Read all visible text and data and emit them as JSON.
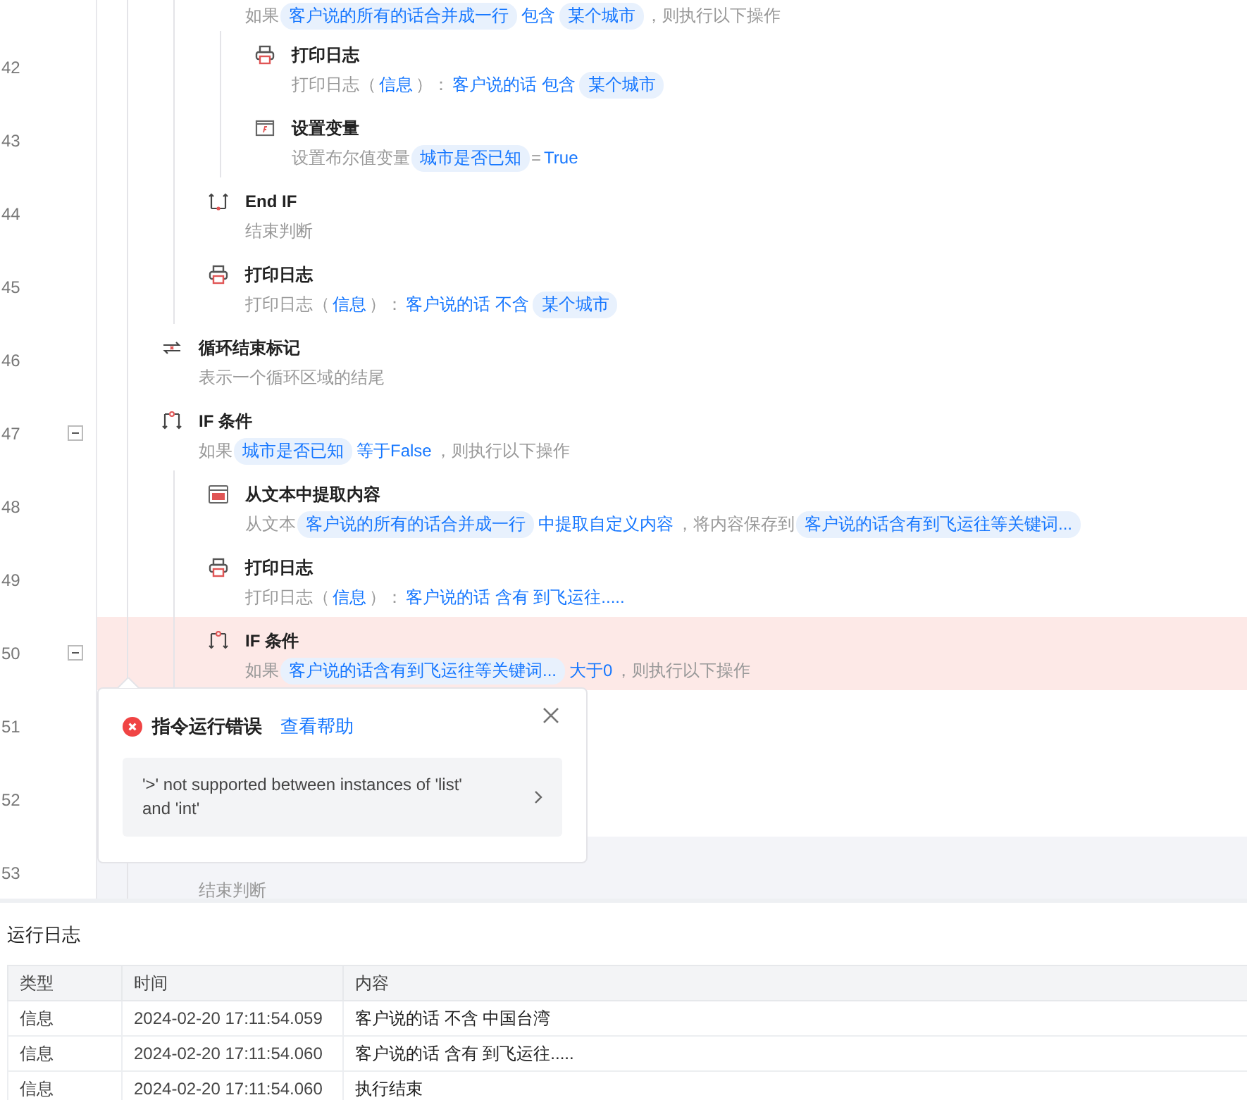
{
  "loop_body": [
    {
      "description": [
        {
          "text": "如果",
          "kind": "plain"
        },
        {
          "text": "客户说的所有的话合并成一行",
          "kind": "var"
        },
        {
          "text": "包含",
          "kind": "value"
        },
        {
          "text": "某个城市",
          "kind": "var"
        },
        {
          "text": "，则执行以下操作",
          "kind": "plain"
        }
      ],
      "children": [
        {
          "line": "42",
          "kind": "print",
          "title": "打印日志",
          "description": [
            {
              "text": "打印日志（",
              "kind": "plain"
            },
            {
              "text": "信息",
              "kind": "value"
            },
            {
              "text": "）：",
              "kind": "plain"
            },
            {
              "text": "客户说的话 包含",
              "kind": "value"
            },
            {
              "text": "某个城市",
              "kind": "var"
            }
          ]
        },
        {
          "line": "43",
          "kind": "variable",
          "title": "设置变量",
          "description": [
            {
              "text": "设置布尔值变量",
              "kind": "plain"
            },
            {
              "text": "城市是否已知",
              "kind": "var"
            },
            {
              "text": "=",
              "kind": "plain"
            },
            {
              "text": "True",
              "kind": "value"
            }
          ]
        }
      ]
    },
    {
      "line": "44",
      "kind": "endif",
      "title": "End IF",
      "description": [
        {
          "text": "结束判断",
          "kind": "plain"
        }
      ]
    },
    {
      "line": "45",
      "kind": "print",
      "title": "打印日志",
      "description": [
        {
          "text": "打印日志（",
          "kind": "plain"
        },
        {
          "text": "信息",
          "kind": "value"
        },
        {
          "text": "）：",
          "kind": "plain"
        },
        {
          "text": "客户说的话 不含",
          "kind": "value"
        },
        {
          "text": "某个城市",
          "kind": "var"
        }
      ]
    }
  ],
  "steps": [
    {
      "line": "46",
      "kind": "loopend",
      "title": "循环结束标记",
      "description": [
        {
          "text": "表示一个循环区域的结尾",
          "kind": "plain"
        }
      ]
    },
    {
      "line": "47",
      "kind": "if",
      "title": "IF 条件",
      "expanded": true,
      "description": [
        {
          "text": "如果",
          "kind": "plain"
        },
        {
          "text": "城市是否已知",
          "kind": "var"
        },
        {
          "text": "等于False",
          "kind": "value"
        },
        {
          "text": "，则执行以下操作",
          "kind": "plain"
        }
      ],
      "children": [
        {
          "line": "48",
          "kind": "extract",
          "title": "从文本中提取内容",
          "description": [
            {
              "text": "从文本",
              "kind": "plain"
            },
            {
              "text": "客户说的所有的话合并成一行",
              "kind": "var"
            },
            {
              "text": "中提取自定义内容",
              "kind": "value"
            },
            {
              "text": "，将内容保存到",
              "kind": "plain"
            },
            {
              "text": "客户说的话含有到飞运往等关键词...",
              "kind": "var"
            }
          ]
        },
        {
          "line": "49",
          "kind": "print",
          "title": "打印日志",
          "description": [
            {
              "text": "打印日志（",
              "kind": "plain"
            },
            {
              "text": "信息",
              "kind": "value"
            },
            {
              "text": "）：",
              "kind": "plain"
            },
            {
              "text": "客户说的话 含有 到飞运往.....",
              "kind": "value"
            }
          ]
        },
        {
          "line": "50",
          "kind": "if",
          "title": "IF 条件",
          "error": true,
          "expanded": true,
          "description": [
            {
              "text": "如果",
              "kind": "plain"
            },
            {
              "text": "客户说的话含有到飞运往等关键词...",
              "kind": "var"
            },
            {
              "text": "大于0",
              "kind": "value"
            },
            {
              "text": "，则执行以下操作",
              "kind": "plain"
            }
          ],
          "children": [
            {
              "line": "51"
            },
            {
              "line": "52"
            }
          ]
        }
      ]
    },
    {
      "line": "53",
      "hovered": true,
      "description": [
        {
          "text": "结束判断",
          "kind": "plain"
        }
      ]
    }
  ],
  "error_popup": {
    "title": "指令运行错误",
    "help_link": "查看帮助",
    "message": "'>' not supported between instances of 'list' and 'int'"
  },
  "log": {
    "title": "运行日志",
    "columns": [
      "类型",
      "时间",
      "内容"
    ],
    "rows": [
      [
        "信息",
        "2024-02-20 17:11:54.059",
        "客户说的话 不含 中国台湾"
      ],
      [
        "信息",
        "2024-02-20 17:11:54.060",
        "客户说的话 含有 到飞运往....."
      ],
      [
        "信息",
        "2024-02-20 17:11:54.060",
        "执行结束"
      ]
    ]
  }
}
